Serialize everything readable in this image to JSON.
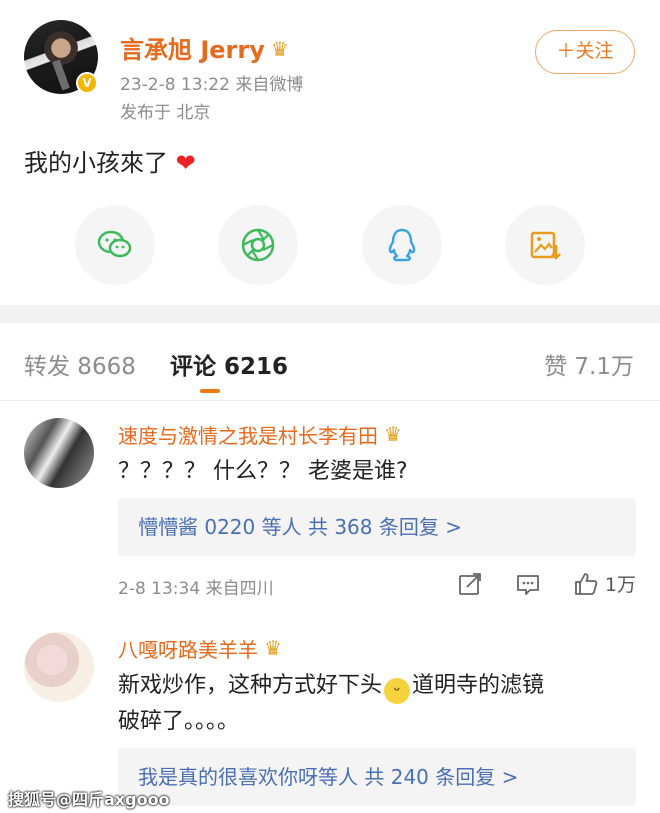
{
  "post": {
    "author": "言承旭 Jerry",
    "crown_icon": "crown-icon",
    "verified_icon": "verified-v-icon",
    "meta": "23-2-8 13:22  来自微博",
    "location": "发布于 北京",
    "follow_label": "＋关注",
    "text": "我的小孩來了",
    "emoji": "❤"
  },
  "share_buttons": [
    {
      "icon": "wechat-icon",
      "color": "#3cba5a"
    },
    {
      "icon": "moments-icon",
      "color": "#3cba5a"
    },
    {
      "icon": "qq-icon",
      "color": "#39a3e6"
    },
    {
      "icon": "save-image-icon",
      "color": "#e89c1e"
    }
  ],
  "tabs": {
    "repost": "转发 8668",
    "comments": "评论 6216",
    "likes": "赞 7.1万"
  },
  "comments": [
    {
      "name": "速度与激情之我是村长李有田",
      "text": "？？？？ 什么？？ 老婆是谁?",
      "reply_summary": "懵懵酱 0220 等人  共 368 条回复 >",
      "meta": "2-8 13:34  来自四川",
      "like_count": "1万"
    },
    {
      "name": "八嘎呀路美羊羊",
      "text_line1": "新戏炒作，这种方式好下头",
      "text_line1b": "道明寺的滤镜",
      "text_line2": "破碎了。。。。",
      "reply_summary": "我是真的很喜欢你呀等人  共 240 条回复 >"
    }
  ],
  "watermark": "搜狐号@四斤axgooo",
  "colors": {
    "accent": "#e56a1d",
    "link": "#4a6fb5",
    "tab_underline": "#f0780f"
  }
}
